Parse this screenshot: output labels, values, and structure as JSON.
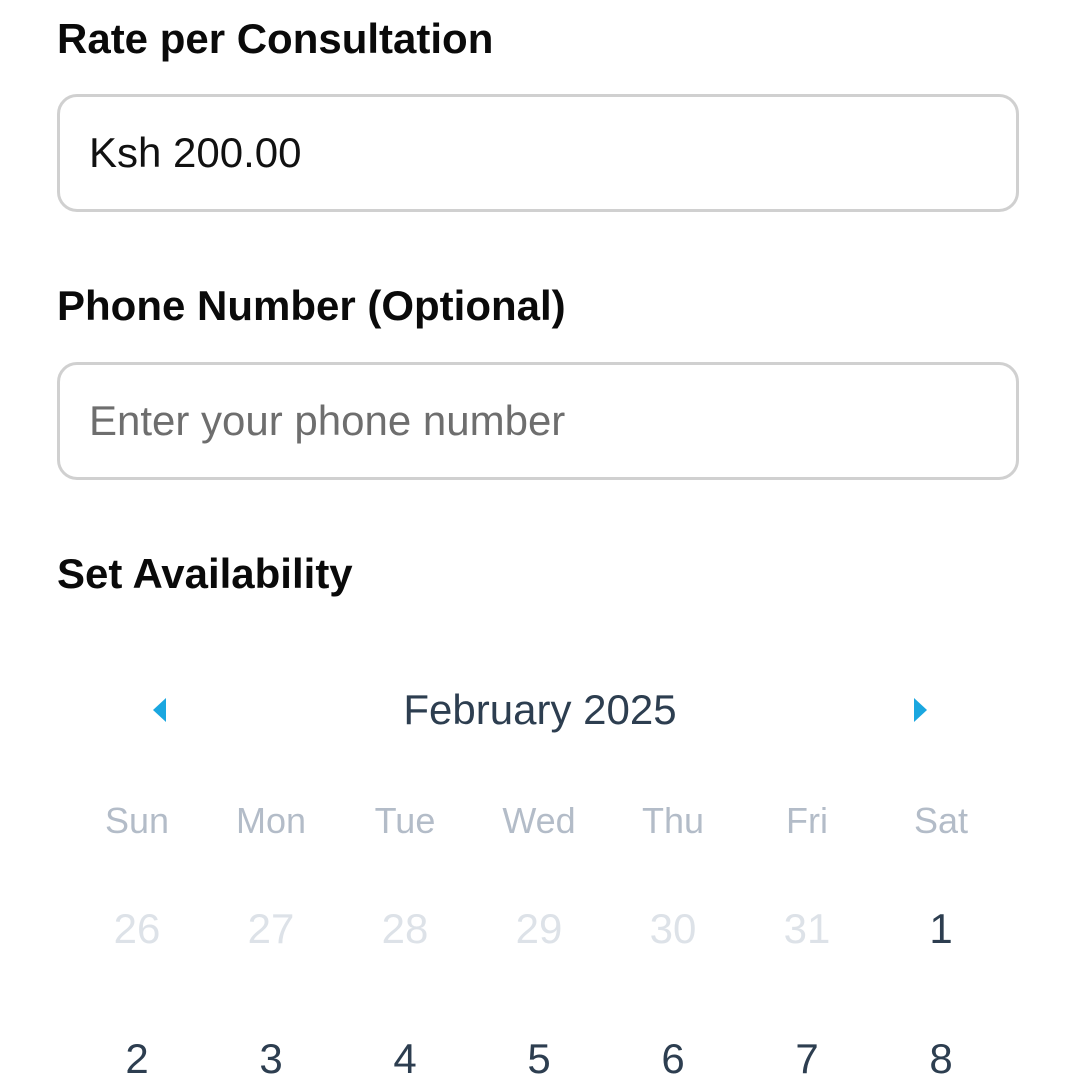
{
  "form": {
    "rate_label": "Rate per Consultation",
    "rate_value": "Ksh 200.00",
    "phone_label": "Phone Number (Optional)",
    "phone_placeholder": "Enter your phone number",
    "availability_label": "Set Availability"
  },
  "calendar": {
    "month_title": "February 2025",
    "weekdays": [
      "Sun",
      "Mon",
      "Tue",
      "Wed",
      "Thu",
      "Fri",
      "Sat"
    ],
    "weeks": [
      [
        {
          "day": "26",
          "in_month": false
        },
        {
          "day": "27",
          "in_month": false
        },
        {
          "day": "28",
          "in_month": false
        },
        {
          "day": "29",
          "in_month": false
        },
        {
          "day": "30",
          "in_month": false
        },
        {
          "day": "31",
          "in_month": false
        },
        {
          "day": "1",
          "in_month": true
        }
      ],
      [
        {
          "day": "2",
          "in_month": true
        },
        {
          "day": "3",
          "in_month": true
        },
        {
          "day": "4",
          "in_month": true
        },
        {
          "day": "5",
          "in_month": true
        },
        {
          "day": "6",
          "in_month": true
        },
        {
          "day": "7",
          "in_month": true
        },
        {
          "day": "8",
          "in_month": true
        }
      ]
    ],
    "prev_icon": "caret-left-icon",
    "next_icon": "caret-right-icon",
    "accent_color": "#1aa7e0"
  }
}
